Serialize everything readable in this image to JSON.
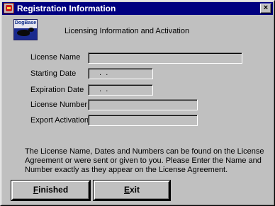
{
  "window": {
    "title": "Registration Information",
    "close_glyph": "×"
  },
  "logo": {
    "text": "DogBase"
  },
  "header": {
    "text": "Licensing Information and Activation"
  },
  "fields": [
    {
      "label": "License Name",
      "value": ""
    },
    {
      "label": "Starting Date",
      "value": " .  ."
    },
    {
      "label": "Expiration Date",
      "value": " .  ."
    },
    {
      "label": "License Number",
      "value": ""
    },
    {
      "label": "Export Activation",
      "value": ""
    }
  ],
  "info": {
    "text": "The License Name, Dates and Numbers can be found on the License Agreement or were sent or given to you. Please Enter the Name and Number exactly as they appear on the License Agreement."
  },
  "buttons": {
    "finished_mnemonic": "F",
    "finished_rest": "inished",
    "exit_mnemonic": "E",
    "exit_rest": "xit"
  }
}
